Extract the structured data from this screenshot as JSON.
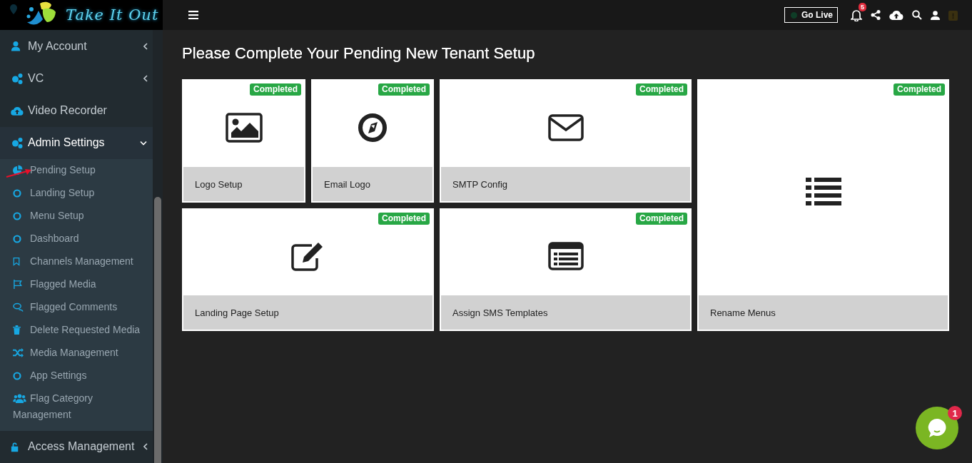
{
  "logo": {
    "text": "Take It Out"
  },
  "sidebar": {
    "items": [
      {
        "label": "My Account",
        "kind": "submenu",
        "expanded": false
      },
      {
        "label": "VC",
        "kind": "submenu",
        "expanded": false
      },
      {
        "label": "Video Recorder",
        "kind": "link"
      },
      {
        "label": "Admin Settings",
        "kind": "submenu",
        "expanded": true,
        "children": [
          {
            "label": "Pending Setup"
          },
          {
            "label": "Landing Setup"
          },
          {
            "label": "Menu Setup"
          },
          {
            "label": "Dashboard"
          },
          {
            "label": "Channels Management"
          },
          {
            "label": "Flagged Media"
          },
          {
            "label": "Flagged Comments"
          },
          {
            "label": "Delete Requested Media"
          },
          {
            "label": "Media Management"
          },
          {
            "label": "App Settings"
          },
          {
            "label": "Flag Category Management"
          }
        ]
      },
      {
        "label": "Access Management",
        "kind": "submenu",
        "expanded": false
      }
    ]
  },
  "top_bar": {
    "go_live": "Go Live",
    "notification_count": "5"
  },
  "page": {
    "title": "Please Complete Your Pending New Tenant Setup",
    "cards": [
      {
        "label": "Logo Setup",
        "status": "Completed"
      },
      {
        "label": "Email Logo",
        "status": "Completed"
      },
      {
        "label": "SMTP Config",
        "status": "Completed"
      },
      {
        "label": "Landing Page Setup",
        "status": "Completed"
      },
      {
        "label": "Assign SMS Templates",
        "status": "Completed"
      }
    ],
    "side_card": {
      "label": "Rename Menus",
      "status": "Completed"
    }
  },
  "chat": {
    "badge": "1"
  }
}
